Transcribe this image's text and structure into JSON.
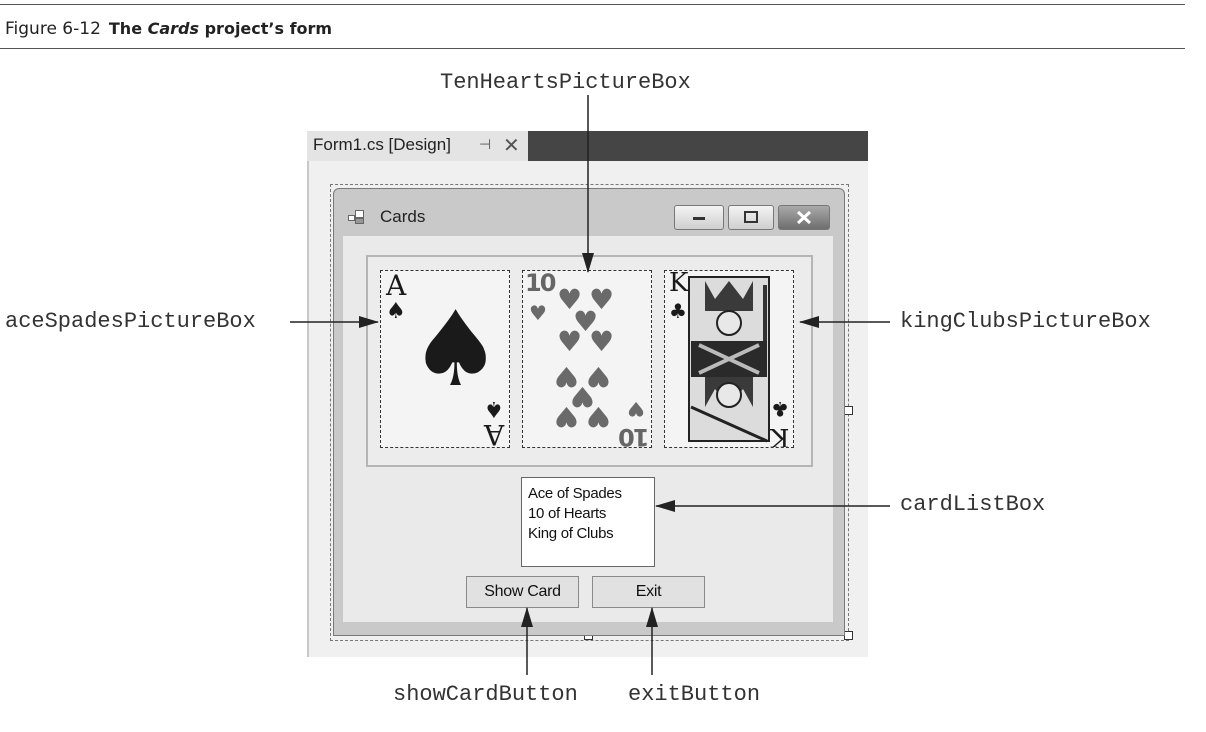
{
  "figure": {
    "number": "Figure 6-12",
    "title_prefix": "The ",
    "title_italic": "Cards",
    "title_suffix": " project’s form"
  },
  "designer": {
    "tab_label": "Form1.cs [Design]",
    "pin_icon": "⊣",
    "close_icon": "✕"
  },
  "form": {
    "title": "Cards",
    "cards": [
      {
        "name": "aceSpadesPictureBox",
        "rank": "A",
        "suit": "♠",
        "suit_color": "#1a1a1a"
      },
      {
        "name": "TenHeartsPictureBox",
        "rank": "10",
        "suit": "♥",
        "suit_color": "#6a6a6a"
      },
      {
        "name": "kingClubsPictureBox",
        "rank": "K",
        "suit": "♣",
        "suit_color": "#1a1a1a"
      }
    ],
    "list_items": [
      "Ace of Spades",
      "10 of Hearts",
      "King of Clubs"
    ],
    "show_card_label": "Show Card",
    "exit_label": "Exit"
  },
  "callouts": {
    "ten_hearts": "TenHeartsPictureBox",
    "ace_spades": "aceSpadesPictureBox",
    "king_clubs": "kingClubsPictureBox",
    "card_list": "cardListBox",
    "show_card": "showCardButton",
    "exit": "exitButton"
  }
}
